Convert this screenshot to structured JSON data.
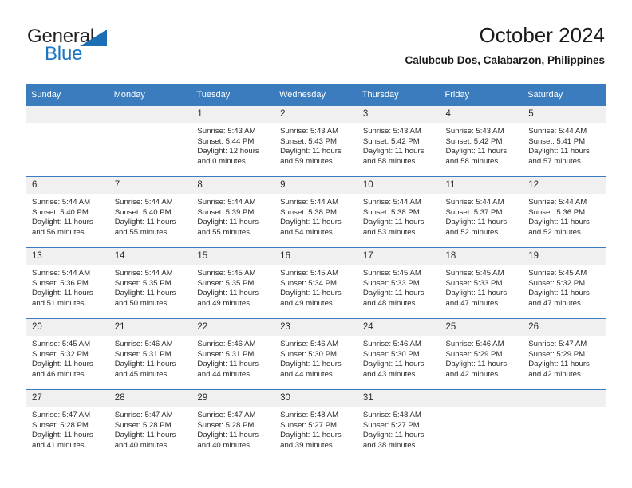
{
  "logo": {
    "text_top": "General",
    "text_bottom": "Blue",
    "triangle_color": "#1a6fb5",
    "top_color": "#231f20",
    "bottom_color": "#1a76c4"
  },
  "header": {
    "title": "October 2024",
    "subtitle": "Calubcub Dos, Calabarzon, Philippines"
  },
  "theme": {
    "header_bg": "#3a7cbe",
    "header_text": "#ffffff",
    "daynum_bg": "#f0f0f0",
    "grid_line": "#3a7cbe"
  },
  "weekday_headers": [
    "Sunday",
    "Monday",
    "Tuesday",
    "Wednesday",
    "Thursday",
    "Friday",
    "Saturday"
  ],
  "weeks": [
    [
      {
        "day": "",
        "lines": []
      },
      {
        "day": "",
        "lines": []
      },
      {
        "day": "1",
        "lines": [
          "Sunrise: 5:43 AM",
          "Sunset: 5:44 PM",
          "Daylight: 12 hours",
          "and 0 minutes."
        ]
      },
      {
        "day": "2",
        "lines": [
          "Sunrise: 5:43 AM",
          "Sunset: 5:43 PM",
          "Daylight: 11 hours",
          "and 59 minutes."
        ]
      },
      {
        "day": "3",
        "lines": [
          "Sunrise: 5:43 AM",
          "Sunset: 5:42 PM",
          "Daylight: 11 hours",
          "and 58 minutes."
        ]
      },
      {
        "day": "4",
        "lines": [
          "Sunrise: 5:43 AM",
          "Sunset: 5:42 PM",
          "Daylight: 11 hours",
          "and 58 minutes."
        ]
      },
      {
        "day": "5",
        "lines": [
          "Sunrise: 5:44 AM",
          "Sunset: 5:41 PM",
          "Daylight: 11 hours",
          "and 57 minutes."
        ]
      }
    ],
    [
      {
        "day": "6",
        "lines": [
          "Sunrise: 5:44 AM",
          "Sunset: 5:40 PM",
          "Daylight: 11 hours",
          "and 56 minutes."
        ]
      },
      {
        "day": "7",
        "lines": [
          "Sunrise: 5:44 AM",
          "Sunset: 5:40 PM",
          "Daylight: 11 hours",
          "and 55 minutes."
        ]
      },
      {
        "day": "8",
        "lines": [
          "Sunrise: 5:44 AM",
          "Sunset: 5:39 PM",
          "Daylight: 11 hours",
          "and 55 minutes."
        ]
      },
      {
        "day": "9",
        "lines": [
          "Sunrise: 5:44 AM",
          "Sunset: 5:38 PM",
          "Daylight: 11 hours",
          "and 54 minutes."
        ]
      },
      {
        "day": "10",
        "lines": [
          "Sunrise: 5:44 AM",
          "Sunset: 5:38 PM",
          "Daylight: 11 hours",
          "and 53 minutes."
        ]
      },
      {
        "day": "11",
        "lines": [
          "Sunrise: 5:44 AM",
          "Sunset: 5:37 PM",
          "Daylight: 11 hours",
          "and 52 minutes."
        ]
      },
      {
        "day": "12",
        "lines": [
          "Sunrise: 5:44 AM",
          "Sunset: 5:36 PM",
          "Daylight: 11 hours",
          "and 52 minutes."
        ]
      }
    ],
    [
      {
        "day": "13",
        "lines": [
          "Sunrise: 5:44 AM",
          "Sunset: 5:36 PM",
          "Daylight: 11 hours",
          "and 51 minutes."
        ]
      },
      {
        "day": "14",
        "lines": [
          "Sunrise: 5:44 AM",
          "Sunset: 5:35 PM",
          "Daylight: 11 hours",
          "and 50 minutes."
        ]
      },
      {
        "day": "15",
        "lines": [
          "Sunrise: 5:45 AM",
          "Sunset: 5:35 PM",
          "Daylight: 11 hours",
          "and 49 minutes."
        ]
      },
      {
        "day": "16",
        "lines": [
          "Sunrise: 5:45 AM",
          "Sunset: 5:34 PM",
          "Daylight: 11 hours",
          "and 49 minutes."
        ]
      },
      {
        "day": "17",
        "lines": [
          "Sunrise: 5:45 AM",
          "Sunset: 5:33 PM",
          "Daylight: 11 hours",
          "and 48 minutes."
        ]
      },
      {
        "day": "18",
        "lines": [
          "Sunrise: 5:45 AM",
          "Sunset: 5:33 PM",
          "Daylight: 11 hours",
          "and 47 minutes."
        ]
      },
      {
        "day": "19",
        "lines": [
          "Sunrise: 5:45 AM",
          "Sunset: 5:32 PM",
          "Daylight: 11 hours",
          "and 47 minutes."
        ]
      }
    ],
    [
      {
        "day": "20",
        "lines": [
          "Sunrise: 5:45 AM",
          "Sunset: 5:32 PM",
          "Daylight: 11 hours",
          "and 46 minutes."
        ]
      },
      {
        "day": "21",
        "lines": [
          "Sunrise: 5:46 AM",
          "Sunset: 5:31 PM",
          "Daylight: 11 hours",
          "and 45 minutes."
        ]
      },
      {
        "day": "22",
        "lines": [
          "Sunrise: 5:46 AM",
          "Sunset: 5:31 PM",
          "Daylight: 11 hours",
          "and 44 minutes."
        ]
      },
      {
        "day": "23",
        "lines": [
          "Sunrise: 5:46 AM",
          "Sunset: 5:30 PM",
          "Daylight: 11 hours",
          "and 44 minutes."
        ]
      },
      {
        "day": "24",
        "lines": [
          "Sunrise: 5:46 AM",
          "Sunset: 5:30 PM",
          "Daylight: 11 hours",
          "and 43 minutes."
        ]
      },
      {
        "day": "25",
        "lines": [
          "Sunrise: 5:46 AM",
          "Sunset: 5:29 PM",
          "Daylight: 11 hours",
          "and 42 minutes."
        ]
      },
      {
        "day": "26",
        "lines": [
          "Sunrise: 5:47 AM",
          "Sunset: 5:29 PM",
          "Daylight: 11 hours",
          "and 42 minutes."
        ]
      }
    ],
    [
      {
        "day": "27",
        "lines": [
          "Sunrise: 5:47 AM",
          "Sunset: 5:28 PM",
          "Daylight: 11 hours",
          "and 41 minutes."
        ]
      },
      {
        "day": "28",
        "lines": [
          "Sunrise: 5:47 AM",
          "Sunset: 5:28 PM",
          "Daylight: 11 hours",
          "and 40 minutes."
        ]
      },
      {
        "day": "29",
        "lines": [
          "Sunrise: 5:47 AM",
          "Sunset: 5:28 PM",
          "Daylight: 11 hours",
          "and 40 minutes."
        ]
      },
      {
        "day": "30",
        "lines": [
          "Sunrise: 5:48 AM",
          "Sunset: 5:27 PM",
          "Daylight: 11 hours",
          "and 39 minutes."
        ]
      },
      {
        "day": "31",
        "lines": [
          "Sunrise: 5:48 AM",
          "Sunset: 5:27 PM",
          "Daylight: 11 hours",
          "and 38 minutes."
        ]
      },
      {
        "day": "",
        "lines": []
      },
      {
        "day": "",
        "lines": []
      }
    ]
  ]
}
